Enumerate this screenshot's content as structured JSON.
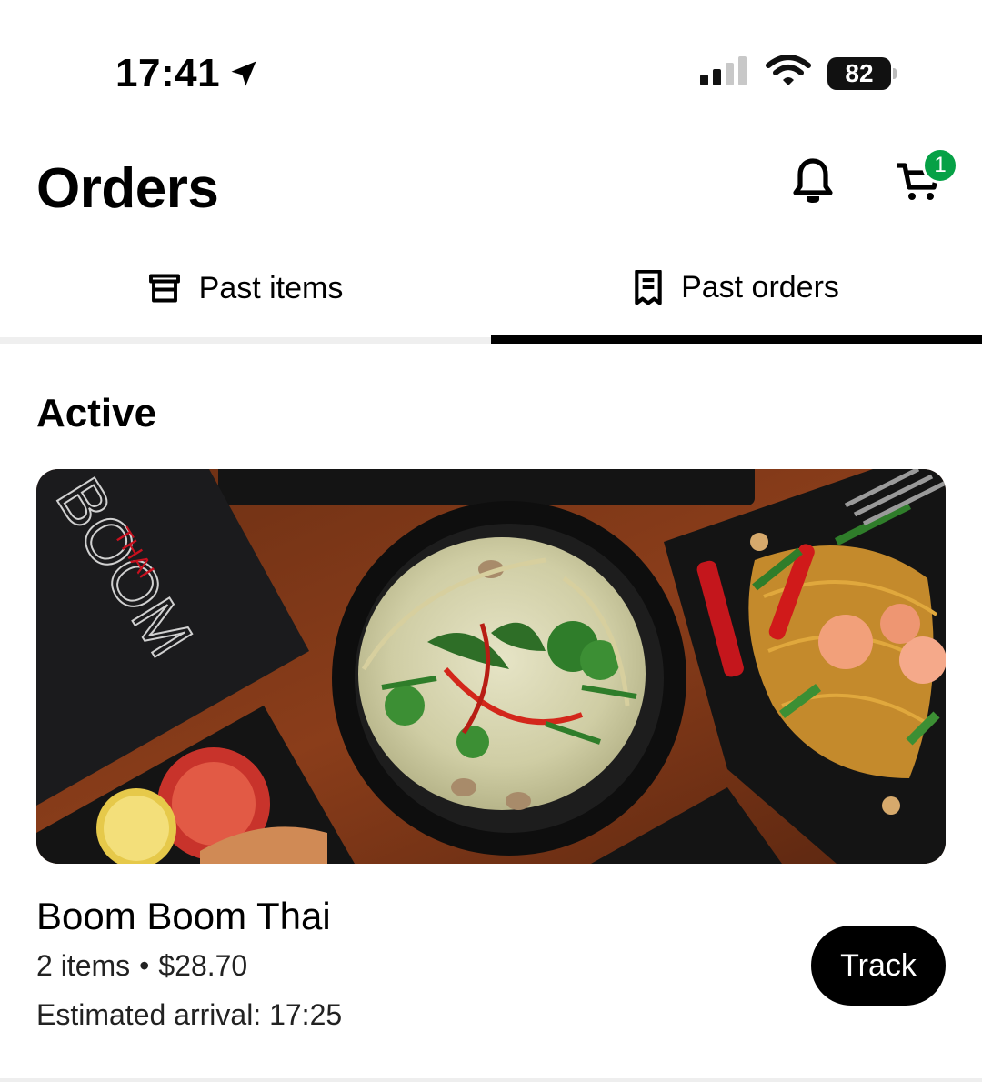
{
  "status_bar": {
    "time": "17:41",
    "battery": "82"
  },
  "header": {
    "title": "Orders",
    "cart_count": "1",
    "badge_color": "#06a146"
  },
  "tabs": [
    {
      "label": "Past items",
      "icon": "basket-icon",
      "active": false
    },
    {
      "label": "Past orders",
      "icon": "receipt-icon",
      "active": true
    }
  ],
  "section": {
    "title": "Active"
  },
  "order": {
    "store_name": "Boom Boom Thai",
    "items": "2 items",
    "separator": "•",
    "total": "$28.70",
    "arrival": "Estimated arrival: 17:25",
    "track_label": "Track",
    "image_brand": "BOOM",
    "image_brand_sub": "THAI"
  }
}
